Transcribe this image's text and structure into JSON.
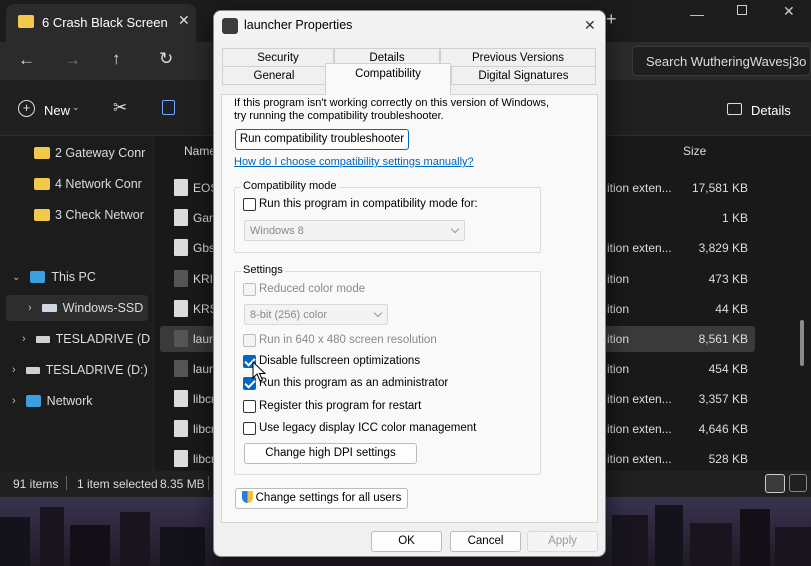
{
  "explorer": {
    "tab_title": "6 Crash Black Screen",
    "search_placeholder": "Search WutheringWavesj3o",
    "new_label": "New",
    "details_label": "Details",
    "column_name": "Name",
    "column_size": "Size",
    "nav_items": [
      {
        "label": "2 Gateway Conr",
        "icon": "folder-icon"
      },
      {
        "label": "4 Network Conr",
        "icon": "folder-icon"
      },
      {
        "label": "3 Check Networ",
        "icon": "folder-icon"
      },
      {
        "label": "This PC",
        "icon": "computer-icon"
      },
      {
        "label": "Windows-SSD",
        "icon": "drive-icon"
      },
      {
        "label": "TESLADRIVE (D",
        "icon": "drive-icon"
      },
      {
        "label": "TESLADRIVE (D:)",
        "icon": "drive-icon"
      },
      {
        "label": "Network",
        "icon": "network-icon"
      }
    ],
    "files": [
      {
        "name": "EOS",
        "type": "ition exten...",
        "size": "17,581 KB"
      },
      {
        "name": "Gan",
        "type": "",
        "size": "1 KB"
      },
      {
        "name": "Gbs",
        "type": "ition exten...",
        "size": "3,829 KB"
      },
      {
        "name": "KRIn",
        "type": "ition",
        "size": "473 KB"
      },
      {
        "name": "KRS",
        "type": "ition",
        "size": "44 KB"
      },
      {
        "name": "laur",
        "type": "ition",
        "size": "8,561 KB"
      },
      {
        "name": "laur",
        "type": "ition",
        "size": "454 KB"
      },
      {
        "name": "libcr",
        "type": "ition exten...",
        "size": "3,357 KB"
      },
      {
        "name": "libcr",
        "type": "ition exten...",
        "size": "4,646 KB"
      },
      {
        "name": "libcr",
        "type": "ition exten...",
        "size": "528 KB"
      }
    ],
    "status": {
      "count": "91 items",
      "selected": "1 item selected",
      "size": "8.35 MB"
    }
  },
  "dialog": {
    "title": "launcher Properties",
    "tabs_top": [
      "Security",
      "Details",
      "Previous Versions"
    ],
    "tabs_bottom": [
      "General",
      "Compatibility",
      "Digital Signatures"
    ],
    "active_tab": "Compatibility",
    "intro_line1": "If this program isn't working correctly on this version of Windows,",
    "intro_line2": "try running the compatibility troubleshooter.",
    "troubleshooter_button": "Run compatibility troubleshooter",
    "manual_link": "How do I choose compatibility settings manually?",
    "compat_mode": {
      "group_label": "Compatibility mode",
      "checkbox_label": "Run this program in compatibility mode for:",
      "checked": false,
      "selected_os": "Windows 8"
    },
    "settings": {
      "group_label": "Settings",
      "reduced_color_label": "Reduced color mode",
      "color_option": "8-bit (256) color",
      "resolution_label": "Run in 640 x 480 screen resolution",
      "fullscreen_label": "Disable fullscreen optimizations",
      "fullscreen_checked": true,
      "admin_label": "Run this program as an administrator",
      "admin_checked": true,
      "restart_label": "Register this program for restart",
      "restart_checked": false,
      "icc_label": "Use legacy display ICC color management",
      "icc_checked": false,
      "dpi_button": "Change high DPI settings"
    },
    "all_users_button": "Change settings for all users",
    "ok_button": "OK",
    "cancel_button": "Cancel",
    "apply_button": "Apply"
  }
}
